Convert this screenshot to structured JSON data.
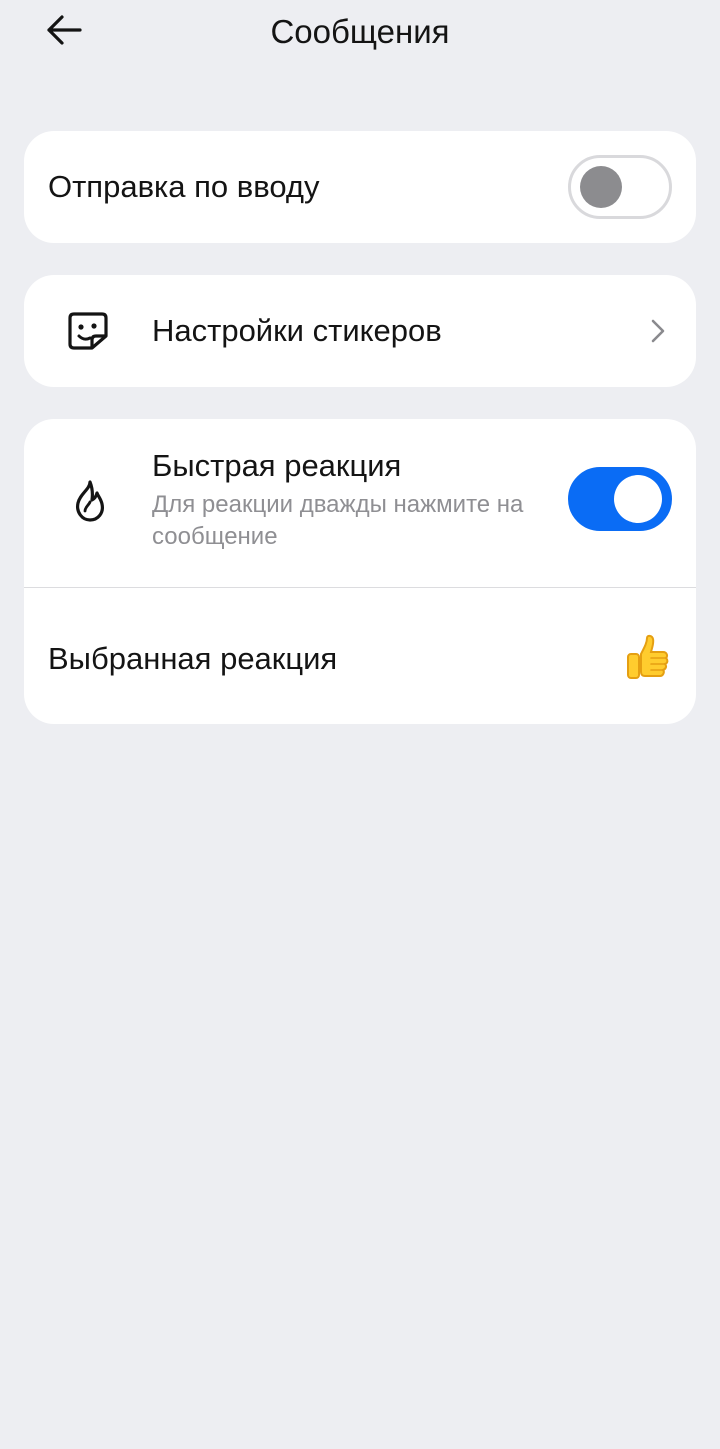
{
  "header": {
    "title": "Сообщения",
    "back_icon": "arrow-left-icon"
  },
  "send_on_enter": {
    "label": "Отправка по вводу",
    "enabled": false
  },
  "sticker_settings": {
    "label": "Настройки стикеров",
    "icon": "sticker-icon",
    "chevron": "chevron-right-icon"
  },
  "quick_reaction": {
    "label": "Быстрая реакция",
    "description": "Для реакции дважды нажмите на сообщение",
    "icon": "flame-icon",
    "enabled": true
  },
  "selected_reaction": {
    "label": "Выбранная реакция",
    "emoji": "👍"
  },
  "colors": {
    "background": "#edeef2",
    "card": "#ffffff",
    "accent": "#0a6cf5",
    "secondary_text": "#8f8f93"
  }
}
